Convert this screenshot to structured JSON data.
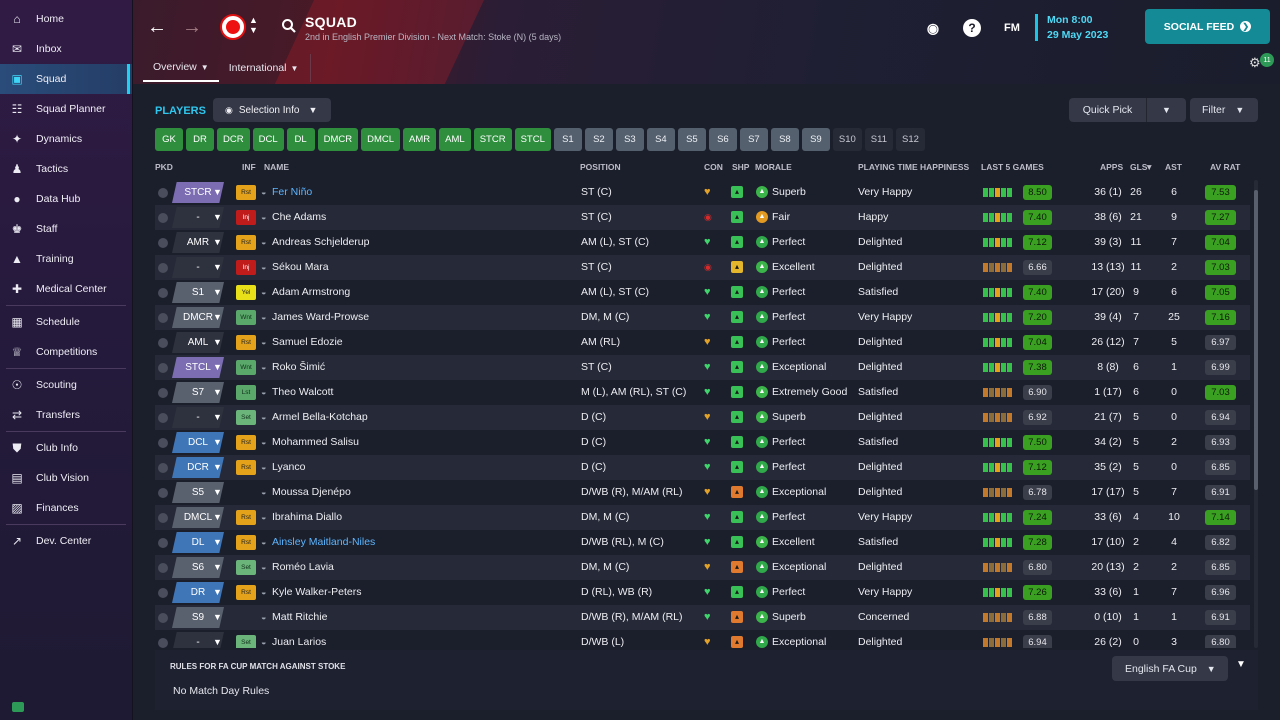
{
  "sidebar": {
    "items": [
      {
        "label": "Home",
        "icon": "home-icon"
      },
      {
        "label": "Inbox",
        "icon": "inbox-icon"
      },
      {
        "label": "Squad",
        "icon": "shirt-icon",
        "active": true
      },
      {
        "label": "Squad Planner",
        "icon": "clipboard-icon"
      },
      {
        "label": "Dynamics",
        "icon": "dynamics-icon"
      },
      {
        "label": "Tactics",
        "icon": "tactics-icon"
      },
      {
        "label": "Data Hub",
        "icon": "data-hub-icon"
      },
      {
        "label": "Staff",
        "icon": "staff-icon"
      },
      {
        "label": "Training",
        "icon": "training-icon"
      },
      {
        "label": "Medical Center",
        "icon": "medical-icon"
      },
      {
        "label": "Schedule",
        "icon": "calendar-icon"
      },
      {
        "label": "Competitions",
        "icon": "trophy-icon"
      },
      {
        "label": "Scouting",
        "icon": "scouting-icon"
      },
      {
        "label": "Transfers",
        "icon": "transfers-icon"
      },
      {
        "label": "Club Info",
        "icon": "shield-icon"
      },
      {
        "label": "Club Vision",
        "icon": "briefcase-icon"
      },
      {
        "label": "Finances",
        "icon": "money-icon"
      },
      {
        "label": "Dev. Center",
        "icon": "dev-center-icon"
      }
    ]
  },
  "header": {
    "title": "SQUAD",
    "subtitle": "2nd in English Premier Division - Next Match: Stoke (N) (5 days)",
    "tabs": [
      "Overview",
      "International"
    ],
    "fm_label": "FM",
    "date_time": "Mon 8:00",
    "date_day": "29 May 2023",
    "social_feed": "SOCIAL FEED",
    "notif_count": "11"
  },
  "toolbar": {
    "players_label": "PLAYERS",
    "selection_info": "Selection Info",
    "quick_pick": "Quick Pick",
    "filter": "Filter"
  },
  "position_filters": [
    "GK",
    "DR",
    "DCR",
    "DCL",
    "DL",
    "DMCR",
    "DMCL",
    "AMR",
    "AML",
    "STCR",
    "STCL",
    "S1",
    "S2",
    "S3",
    "S4",
    "S5",
    "S6",
    "S7",
    "S8",
    "S9",
    "S10",
    "S11",
    "S12"
  ],
  "columns": {
    "pkd": "PKD",
    "inf": "INF",
    "name": "NAME",
    "position": "POSITION",
    "con": "CON",
    "shp": "SHP",
    "morale": "MORALE",
    "happiness": "PLAYING TIME HAPPINESS",
    "last5": "LAST 5 GAMES",
    "apps": "APPS",
    "gls": "GLS",
    "ast": "AST",
    "avrat": "AV RAT"
  },
  "rows": [
    {
      "pkd": "STCR",
      "pkd_style": "purple",
      "inf": "Rst",
      "name": "Fer Niño",
      "link": true,
      "position": "ST (C)",
      "morale": "Superb",
      "happiness": "Very Happy",
      "last5": "8.50",
      "apps": "36 (1)",
      "gls": "26",
      "ast": "6",
      "avrat": "7.53"
    },
    {
      "pkd": "-",
      "pkd_style": "dark",
      "inf": "Inj",
      "name": "Che Adams",
      "position": "ST (C)",
      "morale": "Fair",
      "happiness": "Happy",
      "last5": "7.40",
      "apps": "38 (6)",
      "gls": "21",
      "ast": "9",
      "avrat": "7.27"
    },
    {
      "pkd": "AMR",
      "pkd_style": "dark",
      "inf": "Rst",
      "name": "Andreas Schjelderup",
      "position": "AM (L), ST (C)",
      "morale": "Perfect",
      "happiness": "Delighted",
      "last5": "7.12",
      "apps": "39 (3)",
      "gls": "11",
      "ast": "7",
      "avrat": "7.04"
    },
    {
      "pkd": "-",
      "pkd_style": "dark",
      "inf": "Inj",
      "name": "Sékou Mara",
      "position": "ST (C)",
      "morale": "Excellent",
      "happiness": "Delighted",
      "last5": "6.66",
      "apps": "13 (13)",
      "gls": "11",
      "ast": "2",
      "avrat": "7.03"
    },
    {
      "pkd": "S1",
      "pkd_style": "grey",
      "inf": "Yel",
      "name": "Adam Armstrong",
      "position": "AM (L), ST (C)",
      "morale": "Perfect",
      "happiness": "Satisfied",
      "last5": "7.40",
      "apps": "17 (20)",
      "gls": "9",
      "ast": "6",
      "avrat": "7.05"
    },
    {
      "pkd": "DMCR",
      "pkd_style": "grey",
      "inf": "Wnt",
      "name": "James Ward-Prowse",
      "position": "DM, M (C)",
      "morale": "Perfect",
      "happiness": "Very Happy",
      "last5": "7.20",
      "apps": "39 (4)",
      "gls": "7",
      "ast": "25",
      "avrat": "7.16"
    },
    {
      "pkd": "AML",
      "pkd_style": "dark",
      "inf": "Rst",
      "name": "Samuel Edozie",
      "position": "AM (RL)",
      "morale": "Perfect",
      "happiness": "Delighted",
      "last5": "7.04",
      "apps": "26 (12)",
      "gls": "7",
      "ast": "5",
      "avrat": "6.97"
    },
    {
      "pkd": "STCL",
      "pkd_style": "purple",
      "inf": "Wnt",
      "name": "Roko Šimić",
      "position": "ST (C)",
      "morale": "Exceptional",
      "happiness": "Delighted",
      "last5": "7.38",
      "apps": "8 (8)",
      "gls": "6",
      "ast": "1",
      "avrat": "6.99"
    },
    {
      "pkd": "S7",
      "pkd_style": "grey",
      "inf": "Lst",
      "name": "Theo Walcott",
      "position": "M (L), AM (RL), ST (C)",
      "morale": "Extremely Good",
      "happiness": "Satisfied",
      "last5": "6.90",
      "apps": "1 (17)",
      "gls": "6",
      "ast": "0",
      "avrat": "7.03"
    },
    {
      "pkd": "-",
      "pkd_style": "dark",
      "inf": "Set",
      "name": "Armel Bella-Kotchap",
      "position": "D (C)",
      "morale": "Superb",
      "happiness": "Delighted",
      "last5": "6.92",
      "apps": "21 (7)",
      "gls": "5",
      "ast": "0",
      "avrat": "6.94"
    },
    {
      "pkd": "DCL",
      "pkd_style": "blue",
      "inf": "Rst",
      "name": "Mohammed Salisu",
      "position": "D (C)",
      "morale": "Perfect",
      "happiness": "Satisfied",
      "last5": "7.50",
      "apps": "34 (2)",
      "gls": "5",
      "ast": "2",
      "avrat": "6.93"
    },
    {
      "pkd": "DCR",
      "pkd_style": "blue",
      "inf": "Rst",
      "name": "Lyanco",
      "position": "D (C)",
      "morale": "Perfect",
      "happiness": "Delighted",
      "last5": "7.12",
      "apps": "35 (2)",
      "gls": "5",
      "ast": "0",
      "avrat": "6.85"
    },
    {
      "pkd": "S5",
      "pkd_style": "grey",
      "inf": "",
      "name": "Moussa Djenépo",
      "position": "D/WB (R), M/AM (RL)",
      "morale": "Exceptional",
      "happiness": "Delighted",
      "last5": "6.78",
      "apps": "17 (17)",
      "gls": "5",
      "ast": "7",
      "avrat": "6.91"
    },
    {
      "pkd": "DMCL",
      "pkd_style": "grey",
      "inf": "Rst",
      "name": "Ibrahima Diallo",
      "position": "DM, M (C)",
      "morale": "Perfect",
      "happiness": "Very Happy",
      "last5": "7.24",
      "apps": "33 (6)",
      "gls": "4",
      "ast": "10",
      "avrat": "7.14"
    },
    {
      "pkd": "DL",
      "pkd_style": "blue",
      "inf": "Rst",
      "name": "Ainsley Maitland-Niles",
      "link": true,
      "position": "D/WB (RL), M (C)",
      "morale": "Excellent",
      "happiness": "Satisfied",
      "last5": "7.28",
      "apps": "17 (10)",
      "gls": "2",
      "ast": "4",
      "avrat": "6.82"
    },
    {
      "pkd": "S6",
      "pkd_style": "grey",
      "inf": "Set",
      "name": "Roméo Lavia",
      "position": "DM, M (C)",
      "morale": "Exceptional",
      "happiness": "Delighted",
      "last5": "6.80",
      "apps": "20 (13)",
      "gls": "2",
      "ast": "2",
      "avrat": "6.85"
    },
    {
      "pkd": "DR",
      "pkd_style": "blue",
      "inf": "Rst",
      "name": "Kyle Walker-Peters",
      "position": "D (RL), WB (R)",
      "morale": "Perfect",
      "happiness": "Very Happy",
      "last5": "7.26",
      "apps": "33 (6)",
      "gls": "1",
      "ast": "7",
      "avrat": "6.96"
    },
    {
      "pkd": "S9",
      "pkd_style": "grey",
      "inf": "",
      "name": "Matt Ritchie",
      "position": "D/WB (R), M/AM (RL)",
      "morale": "Superb",
      "happiness": "Concerned",
      "last5": "6.88",
      "apps": "0 (10)",
      "gls": "1",
      "ast": "1",
      "avrat": "6.91"
    },
    {
      "pkd": "-",
      "pkd_style": "dark",
      "inf": "Set",
      "name": "Juan Larios",
      "position": "D/WB (L)",
      "morale": "Exceptional",
      "happiness": "Delighted",
      "last5": "6.94",
      "apps": "26 (2)",
      "gls": "0",
      "ast": "3",
      "avrat": "6.80"
    }
  ],
  "rules": {
    "title": "RULES FOR FA CUP MATCH AGAINST STOKE",
    "text": "No Match Day Rules",
    "competition": "English FA Cup"
  }
}
